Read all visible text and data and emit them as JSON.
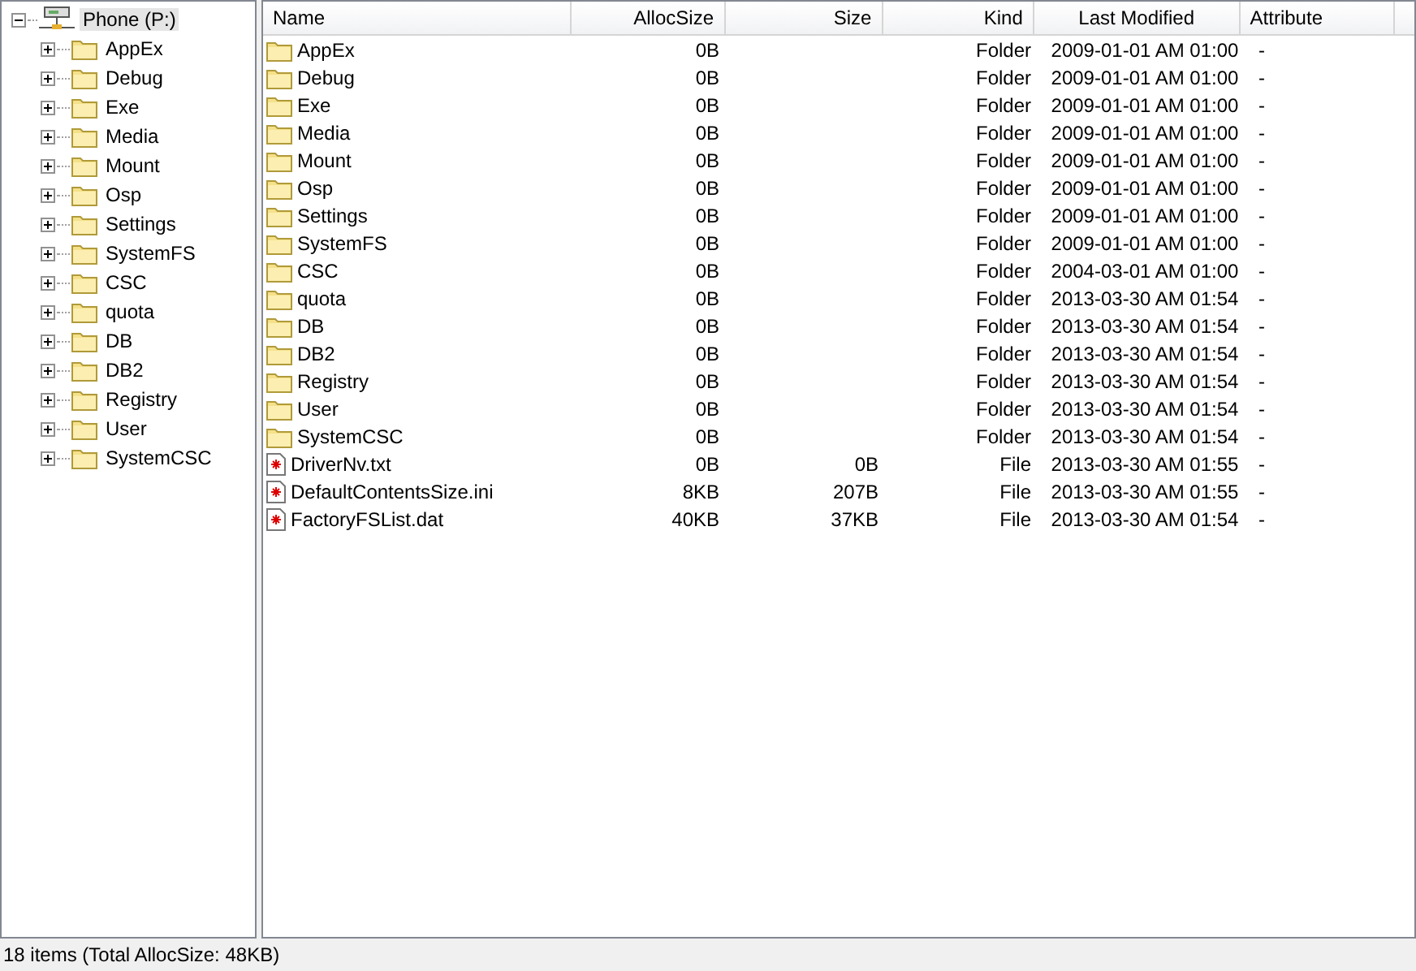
{
  "tree": {
    "root": {
      "label": "Phone (P:)",
      "expanded": true,
      "selected": true,
      "children": [
        {
          "label": "AppEx",
          "expanded": false,
          "selected": false
        },
        {
          "label": "Debug",
          "expanded": false,
          "selected": false
        },
        {
          "label": "Exe",
          "expanded": false,
          "selected": false
        },
        {
          "label": "Media",
          "expanded": false,
          "selected": false
        },
        {
          "label": "Mount",
          "expanded": false,
          "selected": false
        },
        {
          "label": "Osp",
          "expanded": false,
          "selected": false
        },
        {
          "label": "Settings",
          "expanded": false,
          "selected": false
        },
        {
          "label": "SystemFS",
          "expanded": false,
          "selected": false
        },
        {
          "label": "CSC",
          "expanded": false,
          "selected": false
        },
        {
          "label": "quota",
          "expanded": false,
          "selected": false
        },
        {
          "label": "DB",
          "expanded": false,
          "selected": false
        },
        {
          "label": "DB2",
          "expanded": false,
          "selected": false
        },
        {
          "label": "Registry",
          "expanded": false,
          "selected": false
        },
        {
          "label": "User",
          "expanded": false,
          "selected": false
        },
        {
          "label": "SystemCSC",
          "expanded": false,
          "selected": false
        }
      ]
    }
  },
  "table": {
    "columns": [
      "Name",
      "AllocSize",
      "Size",
      "Kind",
      "Last Modified",
      "Attribute"
    ],
    "rows": [
      {
        "kind": "folder",
        "name": "AppEx",
        "alloc_size": "0B",
        "kind_label": "Folder",
        "modified": "2009-01-01 AM 01:00",
        "attribute": "-"
      },
      {
        "kind": "folder",
        "name": "Debug",
        "alloc_size": "0B",
        "kind_label": "Folder",
        "modified": "2009-01-01 AM 01:00",
        "attribute": "-"
      },
      {
        "kind": "folder",
        "name": "Exe",
        "alloc_size": "0B",
        "kind_label": "Folder",
        "modified": "2009-01-01 AM 01:00",
        "attribute": "-"
      },
      {
        "kind": "folder",
        "name": "Media",
        "alloc_size": "0B",
        "kind_label": "Folder",
        "modified": "2009-01-01 AM 01:00",
        "attribute": "-"
      },
      {
        "kind": "folder",
        "name": "Mount",
        "alloc_size": "0B",
        "kind_label": "Folder",
        "modified": "2009-01-01 AM 01:00",
        "attribute": "-"
      },
      {
        "kind": "folder",
        "name": "Osp",
        "alloc_size": "0B",
        "kind_label": "Folder",
        "modified": "2009-01-01 AM 01:00",
        "attribute": "-"
      },
      {
        "kind": "folder",
        "name": "Settings",
        "alloc_size": "0B",
        "kind_label": "Folder",
        "modified": "2009-01-01 AM 01:00",
        "attribute": "-"
      },
      {
        "kind": "folder",
        "name": "SystemFS",
        "alloc_size": "0B",
        "kind_label": "Folder",
        "modified": "2009-01-01 AM 01:00",
        "attribute": "-"
      },
      {
        "kind": "folder",
        "name": "CSC",
        "alloc_size": "0B",
        "kind_label": "Folder",
        "modified": "2004-03-01 AM 01:00",
        "attribute": "-"
      },
      {
        "kind": "folder",
        "name": "quota",
        "alloc_size": "0B",
        "kind_label": "Folder",
        "modified": "2013-03-30 AM 01:54",
        "attribute": "-"
      },
      {
        "kind": "folder",
        "name": "DB",
        "alloc_size": "0B",
        "kind_label": "Folder",
        "modified": "2013-03-30 AM 01:54",
        "attribute": "-"
      },
      {
        "kind": "folder",
        "name": "DB2",
        "alloc_size": "0B",
        "kind_label": "Folder",
        "modified": "2013-03-30 AM 01:54",
        "attribute": "-"
      },
      {
        "kind": "folder",
        "name": "Registry",
        "alloc_size": "0B",
        "kind_label": "Folder",
        "modified": "2013-03-30 AM 01:54",
        "attribute": "-"
      },
      {
        "kind": "folder",
        "name": "User",
        "alloc_size": "0B",
        "kind_label": "Folder",
        "modified": "2013-03-30 AM 01:54",
        "attribute": "-"
      },
      {
        "kind": "folder",
        "name": "SystemCSC",
        "alloc_size": "0B",
        "kind_label": "Folder",
        "modified": "2013-03-30 AM 01:54",
        "attribute": "-"
      },
      {
        "kind": "file",
        "name": "DriverNv.txt",
        "alloc_size": "0B",
        "size": "0B",
        "kind_label": "File",
        "modified": "2013-03-30 AM 01:55",
        "attribute": "-"
      },
      {
        "kind": "file",
        "name": "DefaultContentsSize.ini",
        "alloc_size": "8KB",
        "size": "207B",
        "kind_label": "File",
        "modified": "2013-03-30 AM 01:55",
        "attribute": "-"
      },
      {
        "kind": "file",
        "name": "FactoryFSList.dat",
        "alloc_size": "40KB",
        "size": "37KB",
        "kind_label": "File",
        "modified": "2013-03-30 AM 01:54",
        "attribute": "-"
      }
    ]
  },
  "status_bar": "18 items (Total AllocSize: 48KB)"
}
